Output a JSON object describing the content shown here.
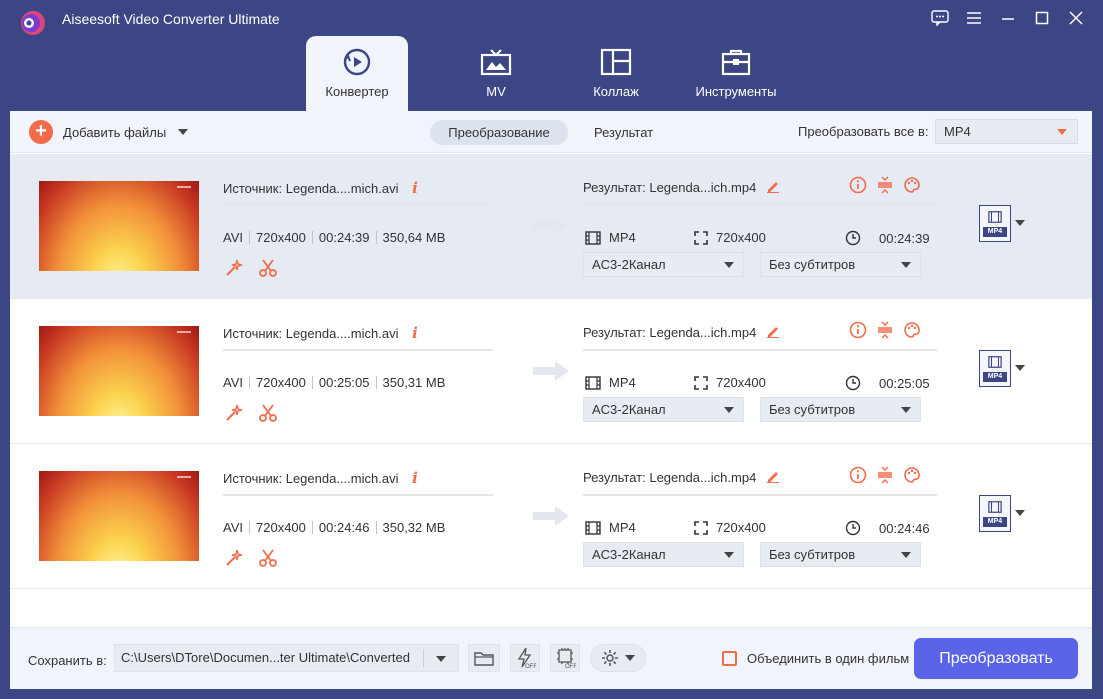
{
  "window": {
    "title": "Aiseesoft Video Converter Ultimate"
  },
  "tabs": [
    {
      "label": "Конвертер",
      "icon": "converter-icon",
      "active": true
    },
    {
      "label": "MV",
      "icon": "tv-icon",
      "active": false
    },
    {
      "label": "Коллаж",
      "icon": "collage-icon",
      "active": false
    },
    {
      "label": "Инструменты",
      "icon": "toolbox-icon",
      "active": false
    }
  ],
  "toolbar": {
    "add_files": "Добавить файлы",
    "seg_convert": "Преобразование",
    "seg_result": "Результат",
    "convert_all_label": "Преобразовать все в:",
    "convert_all_value": "MP4"
  },
  "files": [
    {
      "source": "Источник: Legenda....mich.avi",
      "format": "AVI",
      "resolution": "720x400",
      "duration": "00:24:39",
      "size": "350,64 MB",
      "result": "Результат: Legenda...ich.mp4",
      "out_format": "MP4",
      "out_resolution": "720x400",
      "out_duration": "00:24:39",
      "audio": "AC3-2Канал",
      "subtitles": "Без субтитров",
      "format_badge": "MP4"
    },
    {
      "source": "Источник: Legenda....mich.avi",
      "format": "AVI",
      "resolution": "720x400",
      "duration": "00:25:05",
      "size": "350,31 MB",
      "result": "Результат: Legenda...ich.mp4",
      "out_format": "MP4",
      "out_resolution": "720x400",
      "out_duration": "00:25:05",
      "audio": "AC3-2Канал",
      "subtitles": "Без субтитров",
      "format_badge": "MP4"
    },
    {
      "source": "Источник: Legenda....mich.avi",
      "format": "AVI",
      "resolution": "720x400",
      "duration": "00:24:46",
      "size": "350,32 MB",
      "result": "Результат: Legenda...ich.mp4",
      "out_format": "MP4",
      "out_resolution": "720x400",
      "out_duration": "00:24:46",
      "audio": "AC3-2Канал",
      "subtitles": "Без субтитров",
      "format_badge": "MP4"
    }
  ],
  "footer": {
    "save_label": "Сохранить в:",
    "save_path": "C:\\Users\\DTore\\Documen...ter Ultimate\\Converted",
    "merge_label": "Объединить в один фильм",
    "convert_button": "Преобразовать"
  },
  "colors": {
    "accent": "#f26b4a",
    "brand": "#3d4685",
    "primary_button": "#5b63e6"
  }
}
